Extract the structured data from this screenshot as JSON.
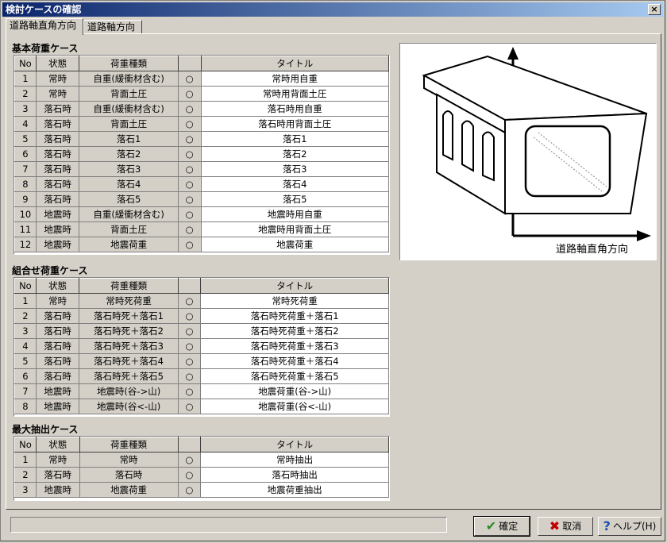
{
  "window": {
    "title": "検討ケースの確認",
    "close_label": "×"
  },
  "tabs": [
    "道路軸直角方向",
    "道路軸方向"
  ],
  "basic": {
    "title": "基本荷重ケース",
    "headers": [
      "No",
      "状態",
      "荷重種類",
      "",
      "タイトル"
    ],
    "rows": [
      [
        "1",
        "常時",
        "自重(緩衝材含む)",
        "○",
        "常時用自重"
      ],
      [
        "2",
        "常時",
        "背面土圧",
        "○",
        "常時用背面土圧"
      ],
      [
        "3",
        "落石時",
        "自重(緩衝材含む)",
        "○",
        "落石時用自重"
      ],
      [
        "4",
        "落石時",
        "背面土圧",
        "○",
        "落石時用背面土圧"
      ],
      [
        "5",
        "落石時",
        "落石1",
        "○",
        "落石1"
      ],
      [
        "6",
        "落石時",
        "落石2",
        "○",
        "落石2"
      ],
      [
        "7",
        "落石時",
        "落石3",
        "○",
        "落石3"
      ],
      [
        "8",
        "落石時",
        "落石4",
        "○",
        "落石4"
      ],
      [
        "9",
        "落石時",
        "落石5",
        "○",
        "落石5"
      ],
      [
        "10",
        "地震時",
        "自重(緩衝材含む)",
        "○",
        "地震時用自重"
      ],
      [
        "11",
        "地震時",
        "背面土圧",
        "○",
        "地震時用背面土圧"
      ],
      [
        "12",
        "地震時",
        "地震荷重",
        "○",
        "地震荷重"
      ]
    ]
  },
  "combo": {
    "title": "組合せ荷重ケース",
    "headers": [
      "No",
      "状態",
      "荷重種類",
      "",
      "タイトル"
    ],
    "rows": [
      [
        "1",
        "常時",
        "常時死荷重",
        "○",
        "常時死荷重"
      ],
      [
        "2",
        "落石時",
        "落石時死＋落石1",
        "○",
        "落石時死荷重＋落石1"
      ],
      [
        "3",
        "落石時",
        "落石時死＋落石2",
        "○",
        "落石時死荷重＋落石2"
      ],
      [
        "4",
        "落石時",
        "落石時死＋落石3",
        "○",
        "落石時死荷重＋落石3"
      ],
      [
        "5",
        "落石時",
        "落石時死＋落石4",
        "○",
        "落石時死荷重＋落石4"
      ],
      [
        "6",
        "落石時",
        "落石時死＋落石5",
        "○",
        "落石時死荷重＋落石5"
      ],
      [
        "7",
        "地震時",
        "地震時(谷->山)",
        "○",
        "地震荷重(谷->山)"
      ],
      [
        "8",
        "地震時",
        "地震時(谷<-山)",
        "○",
        "地震荷重(谷<-山)"
      ]
    ]
  },
  "max": {
    "title": "最大抽出ケース",
    "headers": [
      "No",
      "状態",
      "荷重種類",
      "",
      "タイトル"
    ],
    "rows": [
      [
        "1",
        "常時",
        "常時",
        "○",
        "常時抽出"
      ],
      [
        "2",
        "落石時",
        "落石時",
        "○",
        "落石時抽出"
      ],
      [
        "3",
        "地震時",
        "地震荷重",
        "○",
        "地震荷重抽出"
      ]
    ]
  },
  "diagram": {
    "direction_label": "道路軸直角方向"
  },
  "buttons": {
    "ok": "確定",
    "cancel": "取消",
    "help": "ヘルプ(H)",
    "ok_icon": "checkmark-icon",
    "cancel_icon": "cross-icon",
    "help_icon": "question-icon"
  }
}
